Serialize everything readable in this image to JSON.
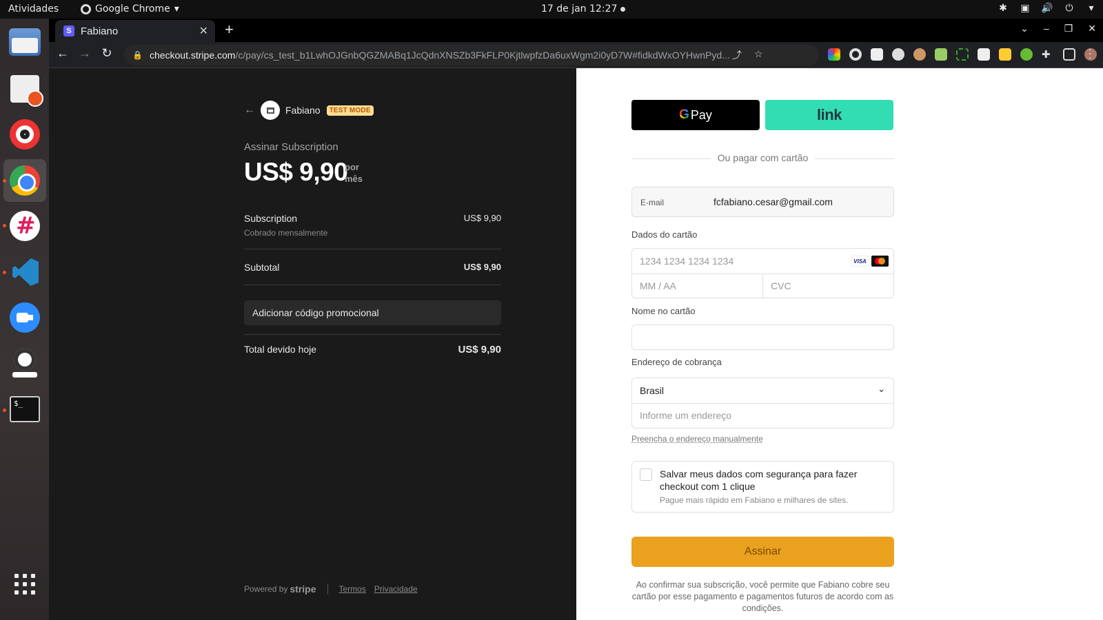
{
  "system": {
    "activities": "Atividades",
    "app_name": "Google Chrome",
    "clock": "17 de jan  12:27"
  },
  "browser": {
    "tab_title": "Fabiano",
    "favicon_letter": "S",
    "url_host": "checkout.stripe.com",
    "url_path": "/c/pay/cs_test_b1LwhOJGnbQGZMABq1JcQdnXNSZb3FkFLP0KjtlwpfzDa6uxWgm2i0yD7W#fidkdWxOYHwnPyd..."
  },
  "summary": {
    "merchant_name": "Fabiano",
    "test_badge": "TEST MODE",
    "subscribe_label": "Assinar Subscription",
    "price": "US$ 9,90",
    "period_line1": "por",
    "period_line2": "mês",
    "item_name": "Subscription",
    "item_desc": "Cobrado mensalmente",
    "item_amount": "US$ 9,90",
    "subtotal_label": "Subtotal",
    "subtotal_amount": "US$ 9,90",
    "promo_label": "Adicionar código promocional",
    "total_label": "Total devido hoje",
    "total_amount": "US$ 9,90",
    "powered_by": "Powered by",
    "stripe": "stripe",
    "terms": "Termos",
    "privacy": "Privacidade"
  },
  "form": {
    "gpay_label": "Pay",
    "link_label": "link",
    "divider_text": "Ou pagar com cartão",
    "email_label": "E-mail",
    "email_value": "fcfabiano.cesar@gmail.com",
    "card_section_label": "Dados do cartão",
    "card_number_placeholder": "1234 1234 1234 1234",
    "expiry_placeholder": "MM / AA",
    "cvc_placeholder": "CVC",
    "visa_label": "VISA",
    "name_label": "Nome no cartão",
    "billing_label": "Endereço de cobrança",
    "country_value": "Brasil",
    "address_placeholder": "Informe um endereço",
    "manual_link": "Preencha o endereço manualmente",
    "save_title": "Salvar meus dados com segurança para fazer checkout com 1 clique",
    "save_subtitle": "Pague mais rápido em Fabiano e milhares de sites.",
    "submit_label": "Assinar",
    "legal_text": "Ao confirmar sua subscrição, você permite que Fabiano cobre seu cartão por esse pagamento e pagamentos futuros de acordo com as condições."
  },
  "colors": {
    "accent_submit": "#e9a11f",
    "link_green": "#33ddb3",
    "test_badge_bg": "#ffde92",
    "stripe_purple": "#635bff"
  }
}
